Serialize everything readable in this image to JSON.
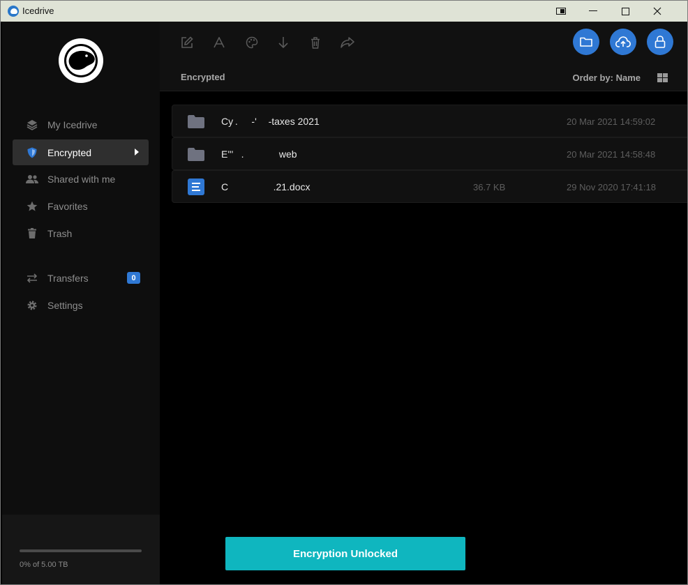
{
  "window": {
    "title": "Icedrive"
  },
  "sidebar": {
    "items": [
      {
        "label": "My Icedrive",
        "icon": "layers-icon"
      },
      {
        "label": "Encrypted",
        "icon": "shield-icon",
        "active": true
      },
      {
        "label": "Shared with me",
        "icon": "users-icon"
      },
      {
        "label": "Favorites",
        "icon": "star-icon"
      },
      {
        "label": "Trash",
        "icon": "trash-icon"
      }
    ],
    "secondary": [
      {
        "label": "Transfers",
        "icon": "transfer-icon",
        "badge": "0"
      },
      {
        "label": "Settings",
        "icon": "gear-icon"
      }
    ],
    "storage": {
      "text": "0% of 5.00 TB",
      "percent": 0
    }
  },
  "toolbar": {
    "tools": [
      "edit-icon",
      "rename-icon",
      "palette-icon",
      "download-icon",
      "delete-icon",
      "share-icon"
    ],
    "actions": [
      "new-folder-button",
      "upload-button",
      "lock-button"
    ],
    "breadcrumb": "Encrypted",
    "order_by": "Order by: Name"
  },
  "files": [
    {
      "name": "Cy .       -'      -taxes 2021",
      "type": "folder",
      "size": "",
      "date": "20 Mar 2021 14:59:02"
    },
    {
      "name": "E'''    .                  web",
      "type": "folder",
      "size": "",
      "date": "20 Mar 2021 14:58:48"
    },
    {
      "name": "C                       .21.docx",
      "type": "document",
      "size": "36.7 KB",
      "date": "29 Nov 2020 17:41:18"
    }
  ],
  "toast": {
    "text": "Encryption Unlocked"
  },
  "colors": {
    "accent": "#2f78d4",
    "toast": "#0fb6bf"
  }
}
